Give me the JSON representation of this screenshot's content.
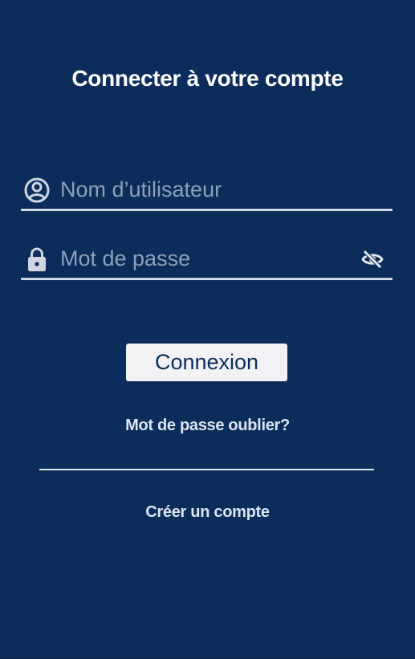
{
  "header": {
    "title": "Connecter à votre compte"
  },
  "form": {
    "username": {
      "placeholder": "Nom d’utilisateur",
      "value": "",
      "icon": "user-circle-icon"
    },
    "password": {
      "placeholder": "Mot de passe",
      "value": "",
      "icon": "lock-icon",
      "toggle_icon": "eye-off-icon"
    },
    "login_label": "Connexion"
  },
  "links": {
    "forgot_password": "Mot de passe oublier?",
    "create_account": "Créer un compte"
  },
  "colors": {
    "background": "#0c2d5b",
    "text": "#ffffff",
    "placeholder": "#8c9fb9",
    "button_bg": "#f2f2f4",
    "underline": "#cfd6e2"
  }
}
